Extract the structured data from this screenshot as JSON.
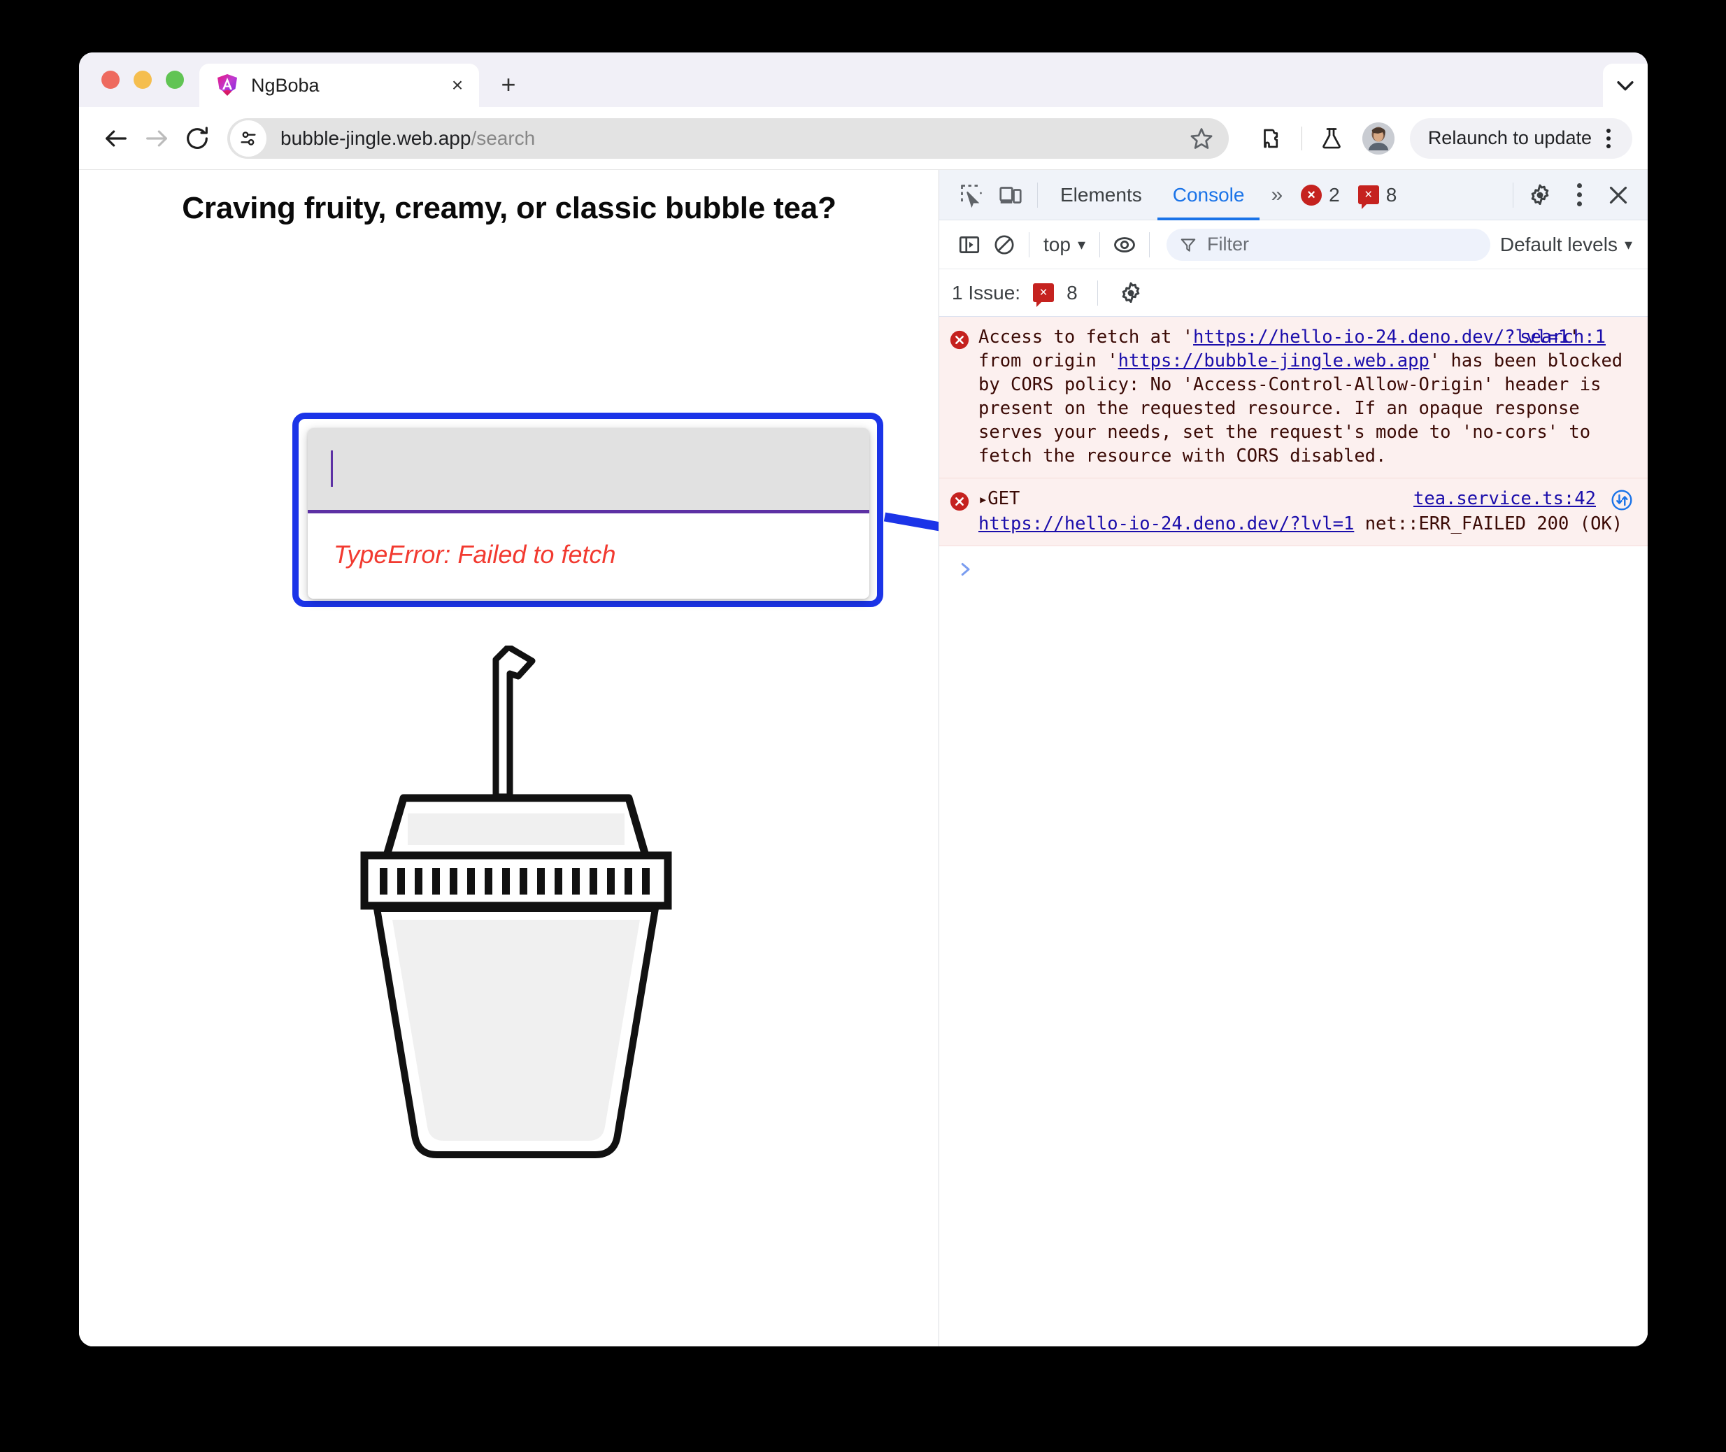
{
  "window": {
    "traffic_lights": [
      "close",
      "minimize",
      "maximize"
    ]
  },
  "tab": {
    "title": "NgBoba",
    "favicon": "angular-logo-icon",
    "close_label": "×",
    "new_tab_label": "+",
    "tabstrip_chevron": "chevron-down-icon"
  },
  "toolbar": {
    "back": "back-arrow-icon",
    "forward": "forward-arrow-icon",
    "reload": "reload-icon",
    "site_info": "tune-settings-icon",
    "url_host": "bubble-jingle.web.app",
    "url_path": "/search",
    "bookmark": "star-outline-icon",
    "extensions": "extension-puzzle-icon",
    "labs": "flask-beaker-icon",
    "avatar": "profile-avatar",
    "relaunch_label": "Relaunch to update",
    "menu": "three-dot-menu-icon"
  },
  "page": {
    "heading": "Craving fruity, creamy, or classic bubble tea?",
    "search_input_value": "",
    "search_input_placeholder": "",
    "error_text": "TypeError: Failed to fetch",
    "illustration_name": "boba-tea-cup-illustration",
    "annotation": "arrow-pointing-to-console-error",
    "colors": {
      "highlight": "#1b34e8",
      "error_red": "#f23a30",
      "input_underline": "#5d31a4",
      "input_bg": "#e1e1e1"
    }
  },
  "devtools": {
    "inspect_icon": "inspect-element-icon",
    "device_icon": "device-toolbar-icon",
    "tabs": [
      {
        "label": "Elements",
        "active": false
      },
      {
        "label": "Console",
        "active": true
      }
    ],
    "more_tabs": "»",
    "error_count": "2",
    "issue_count": "8",
    "error_badge_glyph": "×",
    "issue_badge_glyph": "×",
    "settings_icon": "gear-icon",
    "more_options_icon": "three-dot-menu-icon",
    "close_icon": "close-icon",
    "filterbar": {
      "sidebar_icon": "console-sidebar-icon",
      "clear_icon": "clear-console-icon",
      "context": "top",
      "context_chevron": "▾",
      "live_expression_icon": "eye-icon",
      "filter_icon": "filter-funnel-icon",
      "filter_placeholder": "Filter",
      "levels_label": "Default levels",
      "levels_chevron": "▾"
    },
    "issuebar": {
      "label": "1 Issue:",
      "count": "8",
      "settings_icon": "gear-icon"
    },
    "messages": [
      {
        "type": "error",
        "icon": "error-circle-icon",
        "has_disclosure": false,
        "source": "search:1",
        "text_parts": [
          {
            "t": "Access to fetch at '",
            "link": false
          },
          {
            "t": "https://hello-io-24.deno.dev/?lvl=1",
            "link": true
          },
          {
            "t": "' from origin '",
            "link": false
          },
          {
            "t": "https://bubble-jingle.web.app",
            "link": true
          },
          {
            "t": "' has been blocked by CORS policy: No 'Access-Control-Allow-Origin' header is present on the requested resource. If an opaque response serves your needs, set the request's mode to 'no-cors' to fetch the resource with CORS disabled.",
            "link": false
          }
        ]
      },
      {
        "type": "error",
        "icon": "error-circle-icon",
        "has_disclosure": true,
        "disclosure_glyph": "▸",
        "source": "tea.service.ts:42",
        "network_icon": "open-in-network-panel-icon",
        "text_parts": [
          {
            "t": "GET\n",
            "link": false
          },
          {
            "t": "https://hello-io-24.deno.dev/?lvl=1",
            "link": true
          },
          {
            "t": " net::ERR_FAILED 200 (OK)",
            "link": false
          }
        ]
      }
    ],
    "prompt_caret": "console-prompt-chevron-icon"
  }
}
